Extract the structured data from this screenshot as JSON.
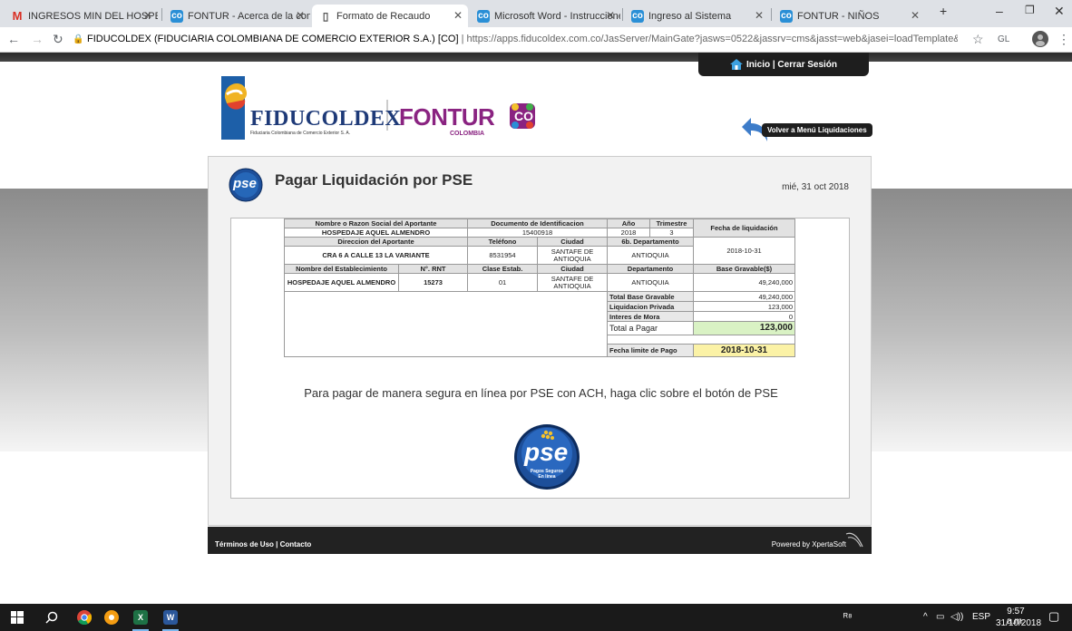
{
  "browser": {
    "tabs": [
      {
        "title": "INGRESOS MIN DEL HOSPEDA",
        "icon": "gmail-icon"
      },
      {
        "title": "FONTUR - Acerca de la contrib",
        "icon": "fontur-icon"
      },
      {
        "title": "Formato de Recaudo",
        "icon": "document-icon"
      },
      {
        "title": "Microsoft Word - Instrucciones",
        "icon": "fontur-icon"
      },
      {
        "title": "Ingreso al Sistema",
        "icon": "fontur-icon"
      },
      {
        "title": "FONTUR - NIÑOS",
        "icon": "fontur-icon"
      }
    ],
    "url_host": "FIDUCOLDEX (FIDUCIARIA COLOMBIANA DE COMERCIO EXTERIOR S.A.) [CO]",
    "url_path": "https://apps.fiducoldex.com.co/JasServer/MainGate?jasws=0522&jassrv=cms&jasst=web&jasei=loadTemplate&jasapp=fdxturis...",
    "profile": "GL"
  },
  "header": {
    "session_links": "Inicio | Cerrar Sesión",
    "back_link": "Volver a Menú Liquidaciones",
    "logo_fiducoldex": "FIDUCOLDEX",
    "logo_fiducoldex_sub": "Fiduciaria Colombiana de Comercio Exterior S. A.",
    "logo_fontur": "FONTUR",
    "logo_fontur_sub": "COLOMBIA",
    "logo_co": "CO"
  },
  "page": {
    "title": "Pagar Liquidación por PSE",
    "date": "mié, 31 oct 2018",
    "pse_logo_text": "pse",
    "pse_logo_sub": "Pagos Seguros En línea",
    "message": "Para pagar de manera segura en línea por PSE con ACH, haga clic sobre el botón de PSE"
  },
  "table": {
    "h_nombre": "Nombre o Razon Social del Aportante",
    "h_documento": "Documento de Identificacion",
    "h_anio": "Año",
    "h_trimestre": "Trimestre",
    "h_fecha": "Fecha de liquidación",
    "nombre": "HOSPEDAJE AQUEL ALMENDRO",
    "documento": "15400918",
    "anio": "2018",
    "trimestre": "3",
    "fecha": "2018-10-31",
    "h_direccion": "Direccion del Aportante",
    "h_telefono": "Teléfono",
    "h_ciudad": "Ciudad",
    "h_departamento6b": "6b. Departamento",
    "direccion": "CRA 6 A CALLE 13 LA VARIANTE",
    "telefono": "8531954",
    "ciudad": "SANTAFE DE ANTIOQUIA",
    "departamento": "ANTIOQUIA",
    "h_establecimiento": "Nombre del Establecimiento",
    "h_rnt": "N°. RNT",
    "h_clase": "Clase Estab.",
    "h_ciudad2": "Ciudad",
    "h_departamento": "Departamento",
    "h_base": "Base Gravable($)",
    "establecimiento": "HOSPEDAJE AQUEL ALMENDRO",
    "rnt": "15273",
    "clase": "01",
    "ciudad2": "SANTAFE DE ANTIOQUIA",
    "departamento2": "ANTIOQUIA",
    "base": "49,240,000",
    "l_total_base": "Total Base Gravable",
    "total_base": "49,240,000",
    "l_liq_privada": "Liquidacion Privada",
    "liq_privada": "123,000",
    "l_mora": "Interes de Mora",
    "mora": "0",
    "l_total_pagar": "Total a Pagar",
    "total_pagar": "123,000",
    "l_fecha_limite": "Fecha limite de Pago",
    "fecha_limite": "2018-10-31"
  },
  "footer": {
    "links": "Términos de Uso | Contacto",
    "powered": "Powered by XpertaSoft"
  },
  "taskbar": {
    "language": "ESP",
    "time": "9:57 a.m.",
    "date": "31/10/2018"
  }
}
